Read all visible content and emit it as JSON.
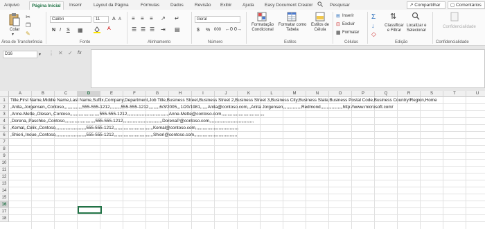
{
  "tabs": [
    {
      "label": "Arquivo",
      "active": false
    },
    {
      "label": "Página Inicial",
      "active": true
    },
    {
      "label": "Inserir",
      "active": false
    },
    {
      "label": "Layout da Página",
      "active": false
    },
    {
      "label": "Fórmulas",
      "active": false
    },
    {
      "label": "Dados",
      "active": false
    },
    {
      "label": "Revisão",
      "active": false
    },
    {
      "label": "Exibir",
      "active": false
    },
    {
      "label": "Ajuda",
      "active": false
    },
    {
      "label": "Easy Document Creator",
      "active": false
    }
  ],
  "search_label": "Pesquisar",
  "share_label": "Compartilhar",
  "comments_label": "Comentários",
  "ribbon": {
    "clipboard": {
      "paste_label": "Colar",
      "group_label": "Área de Transferência"
    },
    "font": {
      "font_name": "Calibri",
      "font_size": "11",
      "bold": "N",
      "italic": "I",
      "underline": "S",
      "grow": "A",
      "shrink": "A",
      "font_color": "A",
      "group_label": "Fonte"
    },
    "alignment": {
      "group_label": "Alinhamento"
    },
    "number": {
      "format": "Geral",
      "currency": "$",
      "percent": "%",
      "thousands": "000",
      "group_label": "Número"
    },
    "styles": {
      "conditional_label": "Formatação",
      "conditional_label2": "Condicional",
      "table_label": "Formatar como",
      "table_label2": "Tabela",
      "cell_styles_label": "Estilos de",
      "cell_styles_label2": "Célula",
      "group_label": "Estilos"
    },
    "cells": {
      "insert_label": "Inserir",
      "delete_label": "Excluir",
      "format_label": "Formatar",
      "group_label": "Células"
    },
    "editing": {
      "sort_label": "Classificar",
      "sort_label2": "e Filtrar",
      "find_label": "Localizar e",
      "find_label2": "Selecionar",
      "group_label": "Edição"
    },
    "confidentiality": {
      "button_label": "Confidencialidade",
      "group_label": "Confidencialidade"
    }
  },
  "formula_bar": {
    "name_box": "D16",
    "fx": "fx",
    "content": ""
  },
  "columns": [
    "A",
    "B",
    "C",
    "D",
    "E",
    "F",
    "G",
    "H",
    "I",
    "J",
    "K",
    "L",
    "M",
    "N",
    "O",
    "P",
    "Q",
    "R",
    "S",
    "T",
    "U"
  ],
  "selected_column": "D",
  "rows": [
    "1",
    "2",
    "3",
    "4",
    "5",
    "6",
    "7",
    "8",
    "9",
    "10",
    "11",
    "12",
    "13",
    "14",
    "15",
    "16",
    "17",
    "18"
  ],
  "selected_row": "16",
  "cells": [
    "Title,First Name,Middle Name,Last Name,Suffix,Company,Department,Job Title,Business Street,Business Street 2,Business Street 3,Business City,Business State,Business Postal Code,Business Country/Region,Home",
    ",Anita,,Jorgensen,,Contoso,,,,,,,,,,,,,,,555-555-1212,,,,,,,,,555-555-1212,,,,,,,,,6/3/2005,,,1/20/1981,,,,,,Anita@contoso.com,,,Anita Jorgensen,,,,,,,,,,,,,,,Redmond,,,,,,,,,,,,,,,,,,http://www.microsoft.com/",
    ",Anne-Mette,,Olesen,,Contoso,,,,,,,,,,,,,,,,,,,,,,,,555-555-1212,,,,,,,,,,,,,,,,,,,,,,,,,,,,,,,,,,Anne-Mette@contoso.com,,,,,,,,,,,,,,,,,,,,,,,,,,,,,,,,,,,",
    ",Dorena,,Paschke,,Contoso,,,,,,,,,,,,,,,,,,,,,,,,,555-555-1212,,,,,,,,,,,,,,,,,,,,,,,,,,,,,,,,DorenaP@contoso.com,,,,,,,,,,,,,,,,,,,,,,,,,,,,,,,,,,,,",
    ",Kemal,,Celik,,Contoso,,,,,,,,,,,,,,,,,,,,,,,,,555-555-1212,,,,,,,,,,,,,,,,,,,,,,,,,,,,,,,,Kemal@contoso.com,,,,,,,,,,,,,,,,,,,,,,,,,,,,,,,,,,,",
    ",Shiori,,Inoue,,Contoso,,,,,,,,,,,,,,,,,,,,,,,,,555-555-1212,,,,,,,,,,,,,,,,,,,,,,,,,,,,,,,,Shiori@contoso.com,,,,,,,,,,,,,,,,,,,,,,,,,,,,,,,,,,,"
  ],
  "colors": {
    "accent": "#217346",
    "selection": "#217346"
  }
}
